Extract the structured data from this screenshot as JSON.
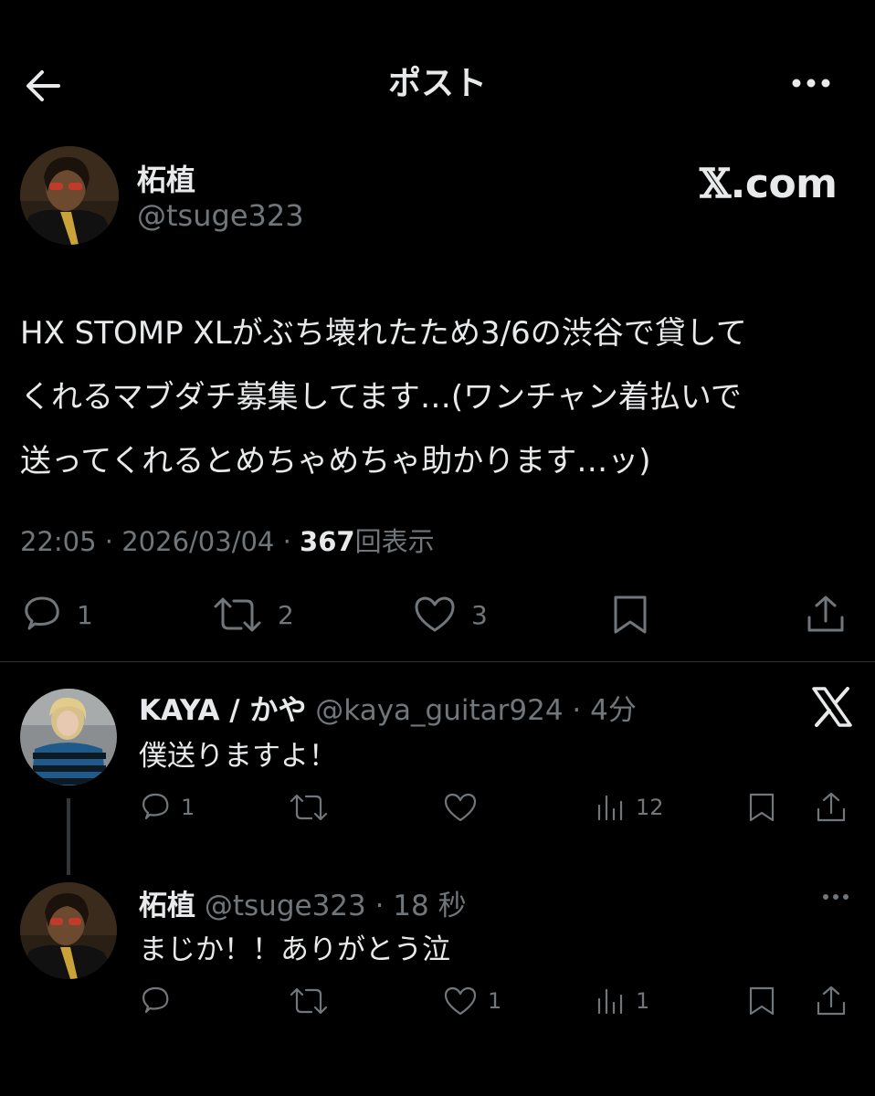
{
  "header": {
    "title": "ポスト",
    "back_icon": "arrow-left-icon",
    "more_icon": "more-horizontal-icon"
  },
  "post": {
    "author_name": "柘植",
    "author_handle": "@tsuge323",
    "watermark_x": "𝕏",
    "watermark_text": ".com",
    "text": "HX STOMP XLがぶち壊れたため3/6の渋谷で貸して\nくれるマブダチ募集してます…(ワンチャン着払いで\n送ってくれるとめちゃめちゃ助かります…ッ)",
    "time": "22:05",
    "sep": "·",
    "date": "2026/03/04",
    "views_count": "367",
    "views_label": "回表示",
    "reply_count": "1",
    "repost_count": "2",
    "like_count": "3"
  },
  "replies": [
    {
      "name": "KAYA / かや",
      "handle": "@kaya_guitar924",
      "time": "4分",
      "text": "僕送りますよ！",
      "reply_count": "1",
      "repost_count": "",
      "like_count": "",
      "view_count": "12"
    },
    {
      "name": "柘植",
      "handle": "@tsuge323",
      "time": "18 秒",
      "text": "まじか！！ありがとう泣",
      "reply_count": "",
      "repost_count": "",
      "like_count": "1",
      "view_count": "1"
    }
  ],
  "colors": {
    "background": "#000000",
    "text": "#e7e9ea",
    "muted": "#71767b",
    "divider": "#2f3336"
  }
}
